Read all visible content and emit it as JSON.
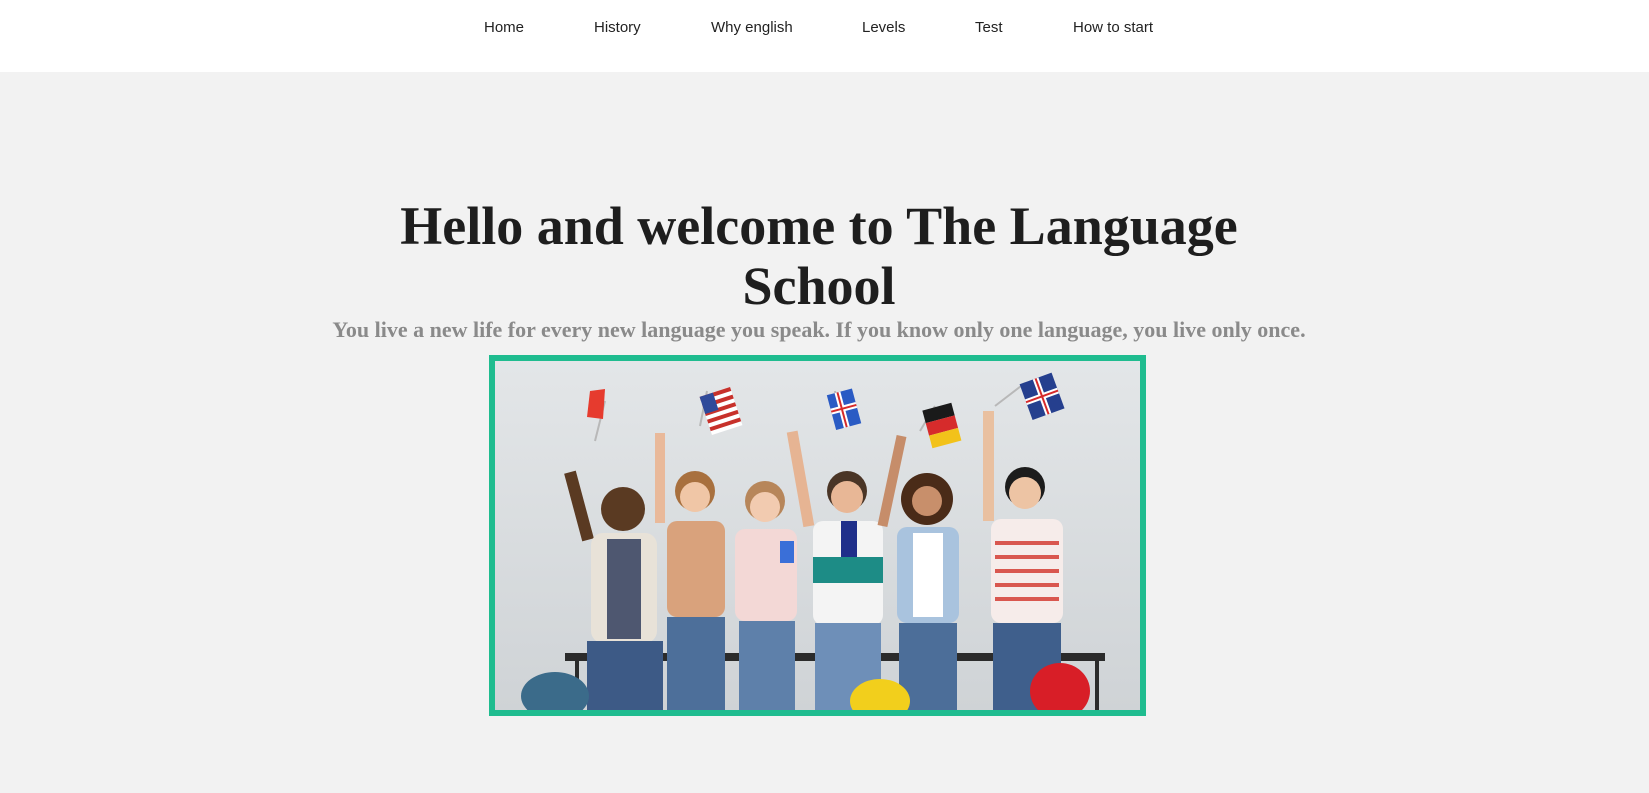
{
  "nav": {
    "items": [
      {
        "label": "Home"
      },
      {
        "label": "History"
      },
      {
        "label": "Why english"
      },
      {
        "label": "Levels"
      },
      {
        "label": "Test"
      },
      {
        "label": "How to start"
      }
    ]
  },
  "hero": {
    "title": "Hello and welcome to The Language School",
    "subtitle": "You live a new life for every new language you speak. If you know only one language, you live only once."
  },
  "colors": {
    "frame_border": "#1fbc8f",
    "hero_background": "#f2f2f2",
    "nav_background": "#ffffff"
  },
  "image": {
    "subject": "group-photo-students-with-flags"
  }
}
